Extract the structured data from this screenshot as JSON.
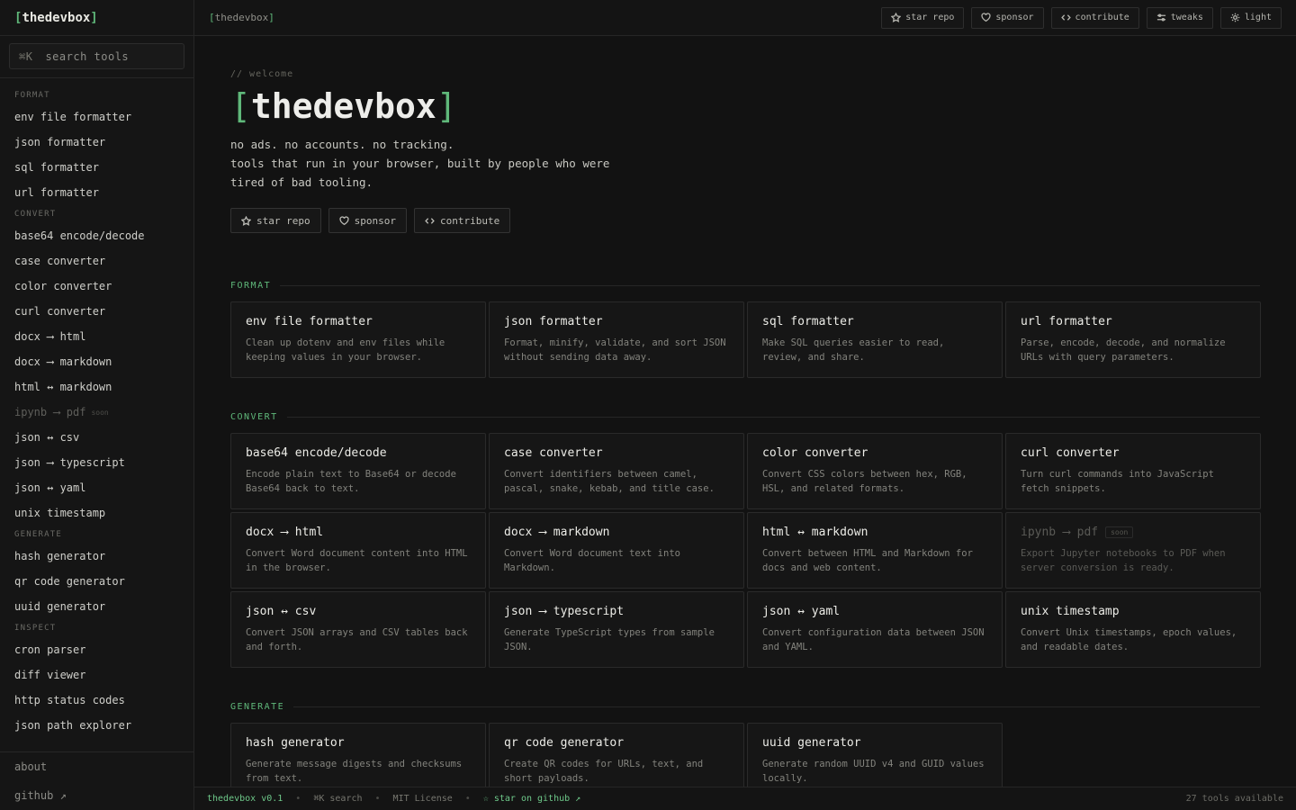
{
  "sidebar": {
    "brand": {
      "open": "[",
      "name": "thedevbox",
      "close": "]"
    },
    "search": {
      "shortcut": "⌘K",
      "placeholder": "search tools"
    },
    "categories": [
      {
        "label": "FORMAT",
        "items": [
          {
            "label": "env file formatter"
          },
          {
            "label": "json formatter"
          },
          {
            "label": "sql formatter"
          },
          {
            "label": "url formatter"
          }
        ]
      },
      {
        "label": "CONVERT",
        "items": [
          {
            "label": "base64 encode/decode"
          },
          {
            "label": "case converter"
          },
          {
            "label": "color converter"
          },
          {
            "label": "curl converter"
          },
          {
            "label": "docx ⟶ html"
          },
          {
            "label": "docx ⟶ markdown"
          },
          {
            "label": "html ↔ markdown"
          },
          {
            "label": "ipynb ⟶ pdf",
            "tag": "soon"
          },
          {
            "label": "json ↔ csv"
          },
          {
            "label": "json ⟶ typescript"
          },
          {
            "label": "json ↔ yaml"
          },
          {
            "label": "unix timestamp"
          }
        ]
      },
      {
        "label": "GENERATE",
        "items": [
          {
            "label": "hash generator"
          },
          {
            "label": "qr code generator"
          },
          {
            "label": "uuid generator"
          }
        ]
      },
      {
        "label": "INSPECT",
        "items": [
          {
            "label": "cron parser"
          },
          {
            "label": "diff viewer"
          },
          {
            "label": "http status codes"
          },
          {
            "label": "json path explorer"
          }
        ]
      }
    ],
    "footer": {
      "about": "about",
      "github": "github ↗"
    }
  },
  "topbar": {
    "crumb_open": "[",
    "crumb": "thedevbox",
    "crumb_close": "]",
    "buttons": [
      {
        "label": "star repo",
        "icon": "star-icon"
      },
      {
        "label": "sponsor",
        "icon": "heart-icon"
      },
      {
        "label": "contribute",
        "icon": "code-icon"
      },
      {
        "label": "tweaks",
        "icon": "sliders-icon"
      },
      {
        "label": "light",
        "icon": "sun-icon"
      }
    ]
  },
  "hero": {
    "kicker": "// welcome",
    "bracket_open": "[",
    "title": "thedevbox",
    "bracket_close": "]",
    "tagline": [
      "no ads. no accounts. no tracking.",
      "tools that run in your browser, built by people who were",
      "tired of bad tooling."
    ],
    "buttons": [
      {
        "label": "star repo",
        "icon": "star-icon"
      },
      {
        "label": "sponsor",
        "icon": "heart-icon"
      },
      {
        "label": "contribute",
        "icon": "code-icon"
      }
    ]
  },
  "sections": [
    {
      "label": "FORMAT",
      "cards": [
        {
          "title": "env file formatter",
          "desc": "Clean up dotenv and env files while keeping values in your browser."
        },
        {
          "title": "json formatter",
          "desc": "Format, minify, validate, and sort JSON without sending data away."
        },
        {
          "title": "sql formatter",
          "desc": "Make SQL queries easier to read, review, and share."
        },
        {
          "title": "url formatter",
          "desc": "Parse, encode, decode, and normalize URLs with query parameters."
        }
      ]
    },
    {
      "label": "CONVERT",
      "cards": [
        {
          "title": "base64 encode/decode",
          "desc": "Encode plain text to Base64 or decode Base64 back to text."
        },
        {
          "title": "case converter",
          "desc": "Convert identifiers between camel, pascal, snake, kebab, and title case."
        },
        {
          "title": "color converter",
          "desc": "Convert CSS colors between hex, RGB, HSL, and related formats."
        },
        {
          "title": "curl converter",
          "desc": "Turn curl commands into JavaScript fetch snippets."
        },
        {
          "title": "docx ⟶ html",
          "desc": "Convert Word document content into HTML in the browser."
        },
        {
          "title": "docx ⟶ markdown",
          "desc": "Convert Word document text into Markdown."
        },
        {
          "title": "html ↔ markdown",
          "desc": "Convert between HTML and Markdown for docs and web content."
        },
        {
          "title": "ipynb ⟶ pdf",
          "desc": "Export Jupyter notebooks to PDF when server conversion is ready.",
          "tag": "soon",
          "dim": true
        },
        {
          "title": "json ↔ csv",
          "desc": "Convert JSON arrays and CSV tables back and forth."
        },
        {
          "title": "json ⟶ typescript",
          "desc": "Generate TypeScript types from sample JSON."
        },
        {
          "title": "json ↔ yaml",
          "desc": "Convert configuration data between JSON and YAML."
        },
        {
          "title": "unix timestamp",
          "desc": "Convert Unix timestamps, epoch values, and readable dates."
        }
      ]
    },
    {
      "label": "GENERATE",
      "cards": [
        {
          "title": "hash generator",
          "desc": "Generate message digests and checksums from text."
        },
        {
          "title": "qr code generator",
          "desc": "Create QR codes for URLs, text, and short payloads."
        },
        {
          "title": "uuid generator",
          "desc": "Generate random UUID v4 and GUID values locally."
        }
      ]
    }
  ],
  "statusbar": {
    "version": "thedevbox v0.1",
    "search": "⌘K search",
    "license": "MIT License",
    "github": "☆ star on github ↗",
    "count": "27 tools available"
  },
  "colors": {
    "accent": "#5fb87a",
    "background": "#121212",
    "card": "#161616",
    "border": "#2a2a2a"
  }
}
